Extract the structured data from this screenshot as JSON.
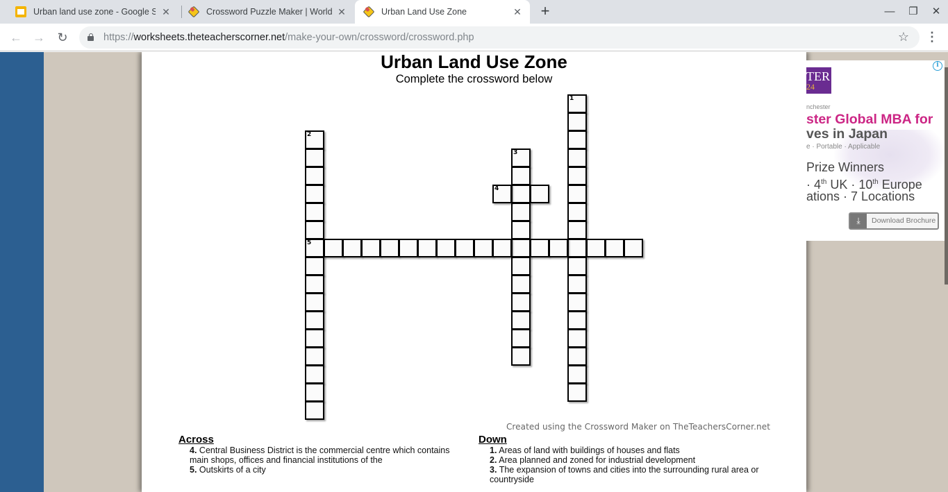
{
  "browser": {
    "tabs": [
      {
        "label": "Urban land use zone - Google Slides",
        "icon": "google-slides-icon",
        "active": false
      },
      {
        "label": "Crossword Puzzle Maker | World Class",
        "icon": "pencil-puzzle-icon",
        "active": false
      },
      {
        "label": "Urban Land Use Zone",
        "icon": "pencil-puzzle-icon",
        "active": true
      }
    ],
    "new_tab_glyph": "+",
    "close_glyph": "✕",
    "window_controls": {
      "minimize": "—",
      "restore": "❐",
      "close": "✕"
    },
    "nav": {
      "back": "←",
      "forward": "→",
      "reload": "↻"
    },
    "url_scheme": "https://",
    "url_host": "worksheets.theteacherscorner.net",
    "url_path": "/make-your-own/crossword/crossword.php",
    "star_glyph": "☆",
    "menu_glyph": "⋮"
  },
  "page": {
    "title": "Urban Land Use Zone",
    "subtitle": "Complete the crossword below",
    "credit": "Created using the Crossword Maker on TheTeachersCorner.net",
    "accent_left_band": "#2c5f91",
    "page_background": "#cfc7bc"
  },
  "crossword": {
    "words": [
      {
        "number": 1,
        "direction": "down",
        "row": 0,
        "col": 14,
        "length": 17
      },
      {
        "number": 2,
        "direction": "down",
        "row": 2,
        "col": 0,
        "length": 16
      },
      {
        "number": 3,
        "direction": "down",
        "row": 3,
        "col": 11,
        "length": 12
      },
      {
        "number": 4,
        "direction": "across",
        "row": 5,
        "col": 10,
        "length": 3
      },
      {
        "number": 5,
        "direction": "across",
        "row": 8,
        "col": 0,
        "length": 18
      }
    ]
  },
  "clues": {
    "across_heading": "Across",
    "down_heading": "Down",
    "across": [
      {
        "number": "4.",
        "text": "Central Business District is the commercial centre which contains main shops, offices and financial institutions of the"
      },
      {
        "number": "5.",
        "text": "Outskirts of a city"
      }
    ],
    "down": [
      {
        "number": "1.",
        "text": "Areas of land with buildings of houses and flats"
      },
      {
        "number": "2.",
        "text": "Area planned and zoned for industrial development"
      },
      {
        "number": "3.",
        "text": "The expansion of towns and cities into the surrounding rural area or countryside"
      }
    ]
  },
  "ad": {
    "logo_text": "TER",
    "logo_year": "24",
    "small_text": "nchester",
    "headline": "ster Global MBA for",
    "headline2": "ves in Japan",
    "tagline": "e · Portable · Applicable",
    "line1": "Prize Winners",
    "line2_a": " · 4",
    "line2_sup1": "th",
    "line2_b": " UK · 10",
    "line2_sup2": "th",
    "line2_c": " Europe",
    "line3": "ations · 7 Locations",
    "button": "Download Brochure",
    "info_glyph": "i",
    "close_glyph": "✕"
  }
}
